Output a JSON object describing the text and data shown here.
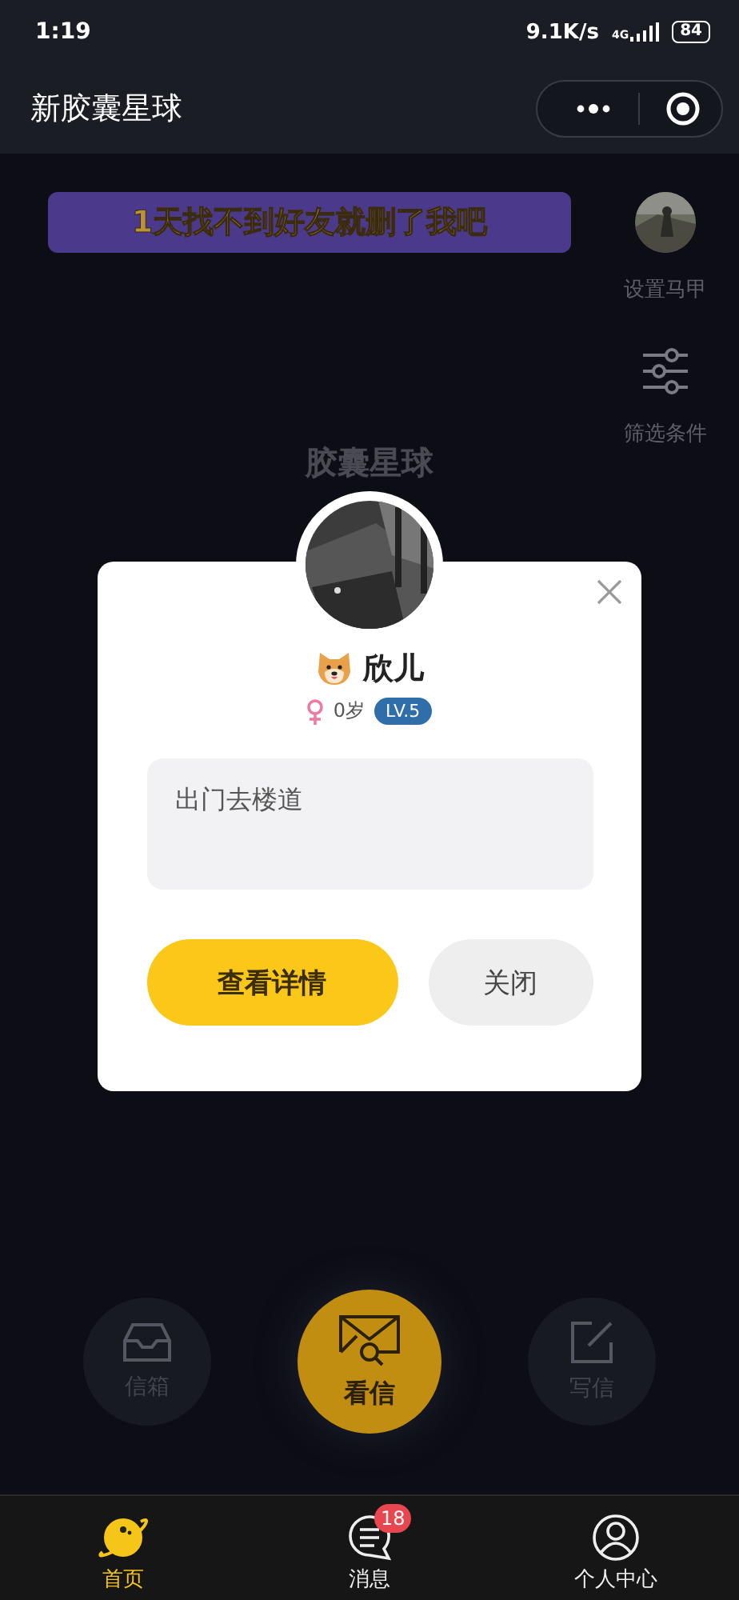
{
  "status_bar": {
    "time": "1:19",
    "speed": "9.1K/s",
    "network": "4G",
    "battery": "84"
  },
  "nav": {
    "title": "新胶囊星球"
  },
  "banner": {
    "text": "1天找不到好友就删了我吧"
  },
  "side_actions": [
    {
      "kind": "avatar",
      "label": "设置马甲"
    },
    {
      "kind": "filter",
      "label": "筛选条件"
    }
  ],
  "heading": "胶囊星球",
  "dialog": {
    "name": "欣儿",
    "female": true,
    "age": "0岁",
    "level": "LV.5",
    "message": "出门去楼道",
    "primary": "查看详情",
    "secondary": "关闭"
  },
  "actions": [
    {
      "kind": "inbox",
      "label": "信箱",
      "primary": false
    },
    {
      "kind": "read",
      "label": "看信",
      "primary": true
    },
    {
      "kind": "write",
      "label": "写信",
      "primary": false
    }
  ],
  "tabs": [
    {
      "kind": "home",
      "label": "首页",
      "selected": true
    },
    {
      "kind": "messages",
      "label": "消息",
      "selected": false,
      "badge": "18"
    },
    {
      "kind": "profile",
      "label": "个人中心",
      "selected": false
    }
  ]
}
